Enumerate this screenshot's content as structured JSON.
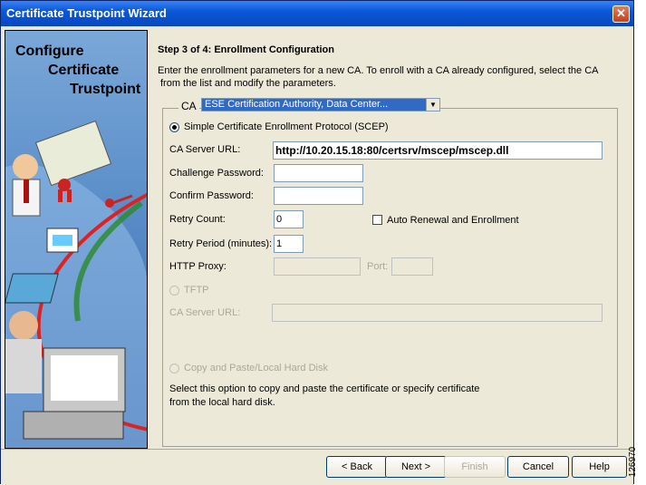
{
  "window": {
    "title": "Certificate Trustpoint Wizard"
  },
  "sidebar": {
    "line1": "Configure",
    "line2": "Certificate",
    "line3": "Trustpoint"
  },
  "step": {
    "title": "Step 3 of 4: Enrollment Configuration",
    "desc1": "Enter the enrollment parameters for a new CA. To enroll with a CA already configured, select the CA",
    "desc2": "from the list and modify the parameters."
  },
  "ca": {
    "label": "CA",
    "selected": "ESE Certification Authority, Data Center..."
  },
  "scep": {
    "label": "Simple Certificate Enrollment Protocol (SCEP)",
    "server_url_label": "CA Server URL:",
    "server_url": "http://10.20.15.18:80/certsrv/mscep/mscep.dll",
    "challenge_label": "Challenge Password:",
    "confirm_label": "Confirm Password:",
    "retry_count_label": "Retry Count:",
    "retry_count": "0",
    "auto_renewal_label": "Auto Renewal and Enrollment",
    "retry_period_label": "Retry Period (minutes):",
    "retry_period": "1",
    "proxy_label": "HTTP Proxy:",
    "port_label": "Port:"
  },
  "tftp": {
    "label": "TFTP",
    "server_url_label": "CA Server URL:"
  },
  "copy": {
    "label": "Copy and Paste/Local Hard Disk",
    "desc1": "Select this option to copy and paste the certificate or specify certificate",
    "desc2": "from the local hard disk."
  },
  "buttons": {
    "back": "< Back",
    "next": "Next >",
    "finish": "Finish",
    "cancel": "Cancel",
    "help": "Help"
  },
  "figure_id": "126970"
}
